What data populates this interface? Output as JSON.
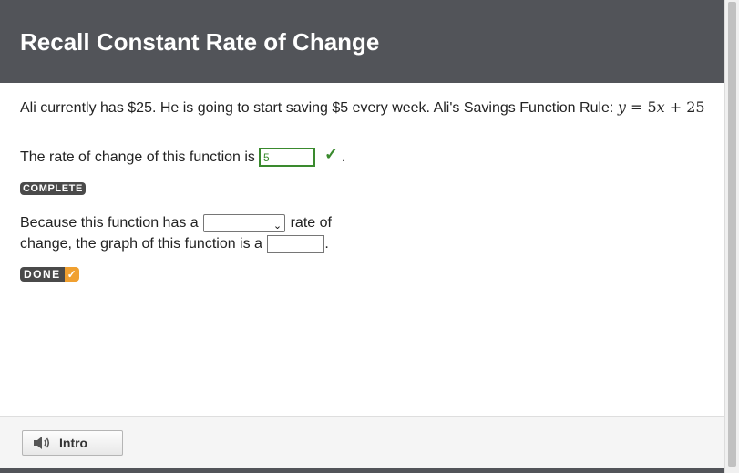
{
  "header": {
    "title": "Recall Constant Rate of Change"
  },
  "problem": {
    "text": "Ali currently has $25. He is going to start saving $5 every week. Ali's Savings Function Rule: ",
    "equation_y": "y",
    "equation_mid": " = 5",
    "equation_x": "x",
    "equation_end": " + 25"
  },
  "rate": {
    "label": "The rate of change of this function is",
    "answer": "5",
    "dot": "."
  },
  "badges": {
    "complete": "COMPLETE",
    "done": "DONE"
  },
  "because": {
    "part1": "Because this function has a",
    "part2": "rate of",
    "part3": "change, the graph of this function is a",
    "end": "."
  },
  "footer": {
    "intro_label": "Intro"
  },
  "colors": {
    "header_bg": "#525459",
    "correct_green": "#3a8a2e",
    "done_orange": "#f0a030"
  },
  "icons": [
    "check-icon",
    "chevron-down-icon",
    "speaker-icon"
  ]
}
